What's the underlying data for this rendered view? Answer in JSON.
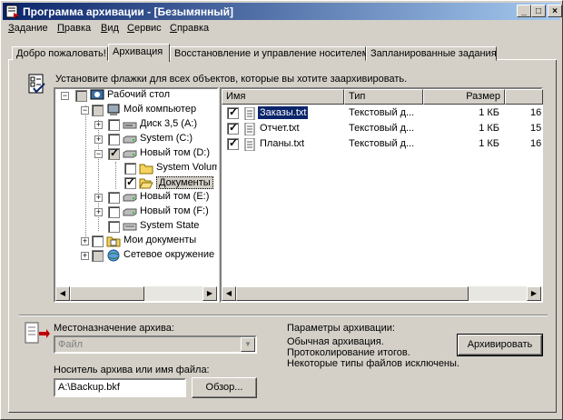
{
  "window": {
    "title": "Программа архивации - [Безымянный]"
  },
  "title_buttons": {
    "minimize": "_",
    "maximize": "□",
    "close": "×"
  },
  "menu": [
    {
      "pre": "",
      "u": "З",
      "post": "адание"
    },
    {
      "pre": "",
      "u": "П",
      "post": "равка"
    },
    {
      "pre": "",
      "u": "В",
      "post": "ид"
    },
    {
      "pre": "",
      "u": "С",
      "post": "ервис"
    },
    {
      "pre": "",
      "u": "С",
      "post": "правка"
    }
  ],
  "tabs": [
    {
      "label": "Добро пожаловать!"
    },
    {
      "label": "Архивация"
    },
    {
      "label": "Восстановление и управление носителем"
    },
    {
      "label": "Запланированные задания"
    }
  ],
  "instruction": "Установите флажки для всех объектов, которые вы хотите заархивировать.",
  "tree": [
    {
      "label": "Рабочий стол"
    },
    {
      "label": "Мой компьютер"
    },
    {
      "label": "Диск 3,5 (A:)"
    },
    {
      "label": "System (C:)"
    },
    {
      "label": "Новый том (D:)"
    },
    {
      "label": "System Volum"
    },
    {
      "label": "Документы"
    },
    {
      "label": "Новый том (E:)"
    },
    {
      "label": "Новый том (F:)"
    },
    {
      "label": "System State"
    },
    {
      "label": "Мои документы"
    },
    {
      "label": "Сетевое окружение"
    }
  ],
  "list": {
    "columns": [
      "Имя",
      "Тип",
      "Размер",
      ""
    ],
    "rows": [
      {
        "name": "Заказы.txt",
        "type": "Текстовый д...",
        "size": "1 КБ",
        "extra": "16"
      },
      {
        "name": "Отчет.txt",
        "type": "Текстовый д...",
        "size": "1 КБ",
        "extra": "15"
      },
      {
        "name": "Планы.txt",
        "type": "Текстовый д...",
        "size": "1 КБ",
        "extra": "16"
      }
    ]
  },
  "destination": {
    "label": "Местоназначение архива:",
    "value": "Файл"
  },
  "media": {
    "label": "Носитель архива или имя файла:",
    "value": "A:\\Backup.bkf",
    "browse": "Обзор..."
  },
  "params": {
    "title": "Параметры архивации:",
    "lines": [
      "Обычная архивация.",
      "Протоколирование итогов.",
      "Некоторые типы файлов исключены."
    ]
  },
  "archive_button": "Архивировать",
  "colors": {
    "title_start": "#0a246a",
    "title_end": "#a6caf0",
    "selection": "#0a246a",
    "folder": "#f4d35e"
  }
}
